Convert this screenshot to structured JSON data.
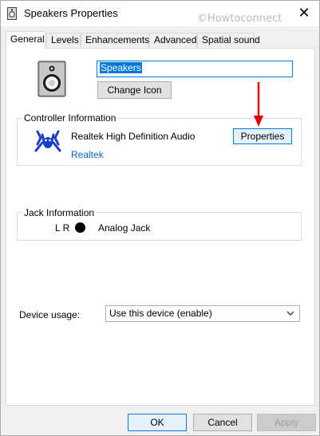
{
  "window": {
    "title": "Speakers Properties",
    "watermark": "©Howtoconnect",
    "close_glyph": "✕"
  },
  "tabs": [
    {
      "label": "General",
      "active": true
    },
    {
      "label": "Levels",
      "active": false
    },
    {
      "label": "Enhancements",
      "active": false
    },
    {
      "label": "Advanced",
      "active": false
    },
    {
      "label": "Spatial sound",
      "active": false
    }
  ],
  "general": {
    "device_name_value": "Speakers",
    "change_icon_label": "Change Icon",
    "controller": {
      "group_label": "Controller Information",
      "name": "Realtek High Definition Audio",
      "vendor_link": "Realtek",
      "properties_label": "Properties"
    },
    "jack": {
      "group_label": "Jack Information",
      "channels": "L R",
      "type": "Analog Jack"
    },
    "device_usage": {
      "label": "Device usage:",
      "selected": "Use this device (enable)"
    }
  },
  "footer": {
    "ok_label": "OK",
    "cancel_label": "Cancel",
    "apply_label": "Apply"
  },
  "icons": {
    "title": "speaker-small-icon",
    "device": "speaker-icon",
    "vendor": "realtek-crab-icon",
    "annotation": "red-arrow-icon"
  },
  "colors": {
    "accent": "#0078d7",
    "link": "#0066cc",
    "annotation_arrow": "#e00000",
    "vendor_logo": "#1a3ec7"
  }
}
